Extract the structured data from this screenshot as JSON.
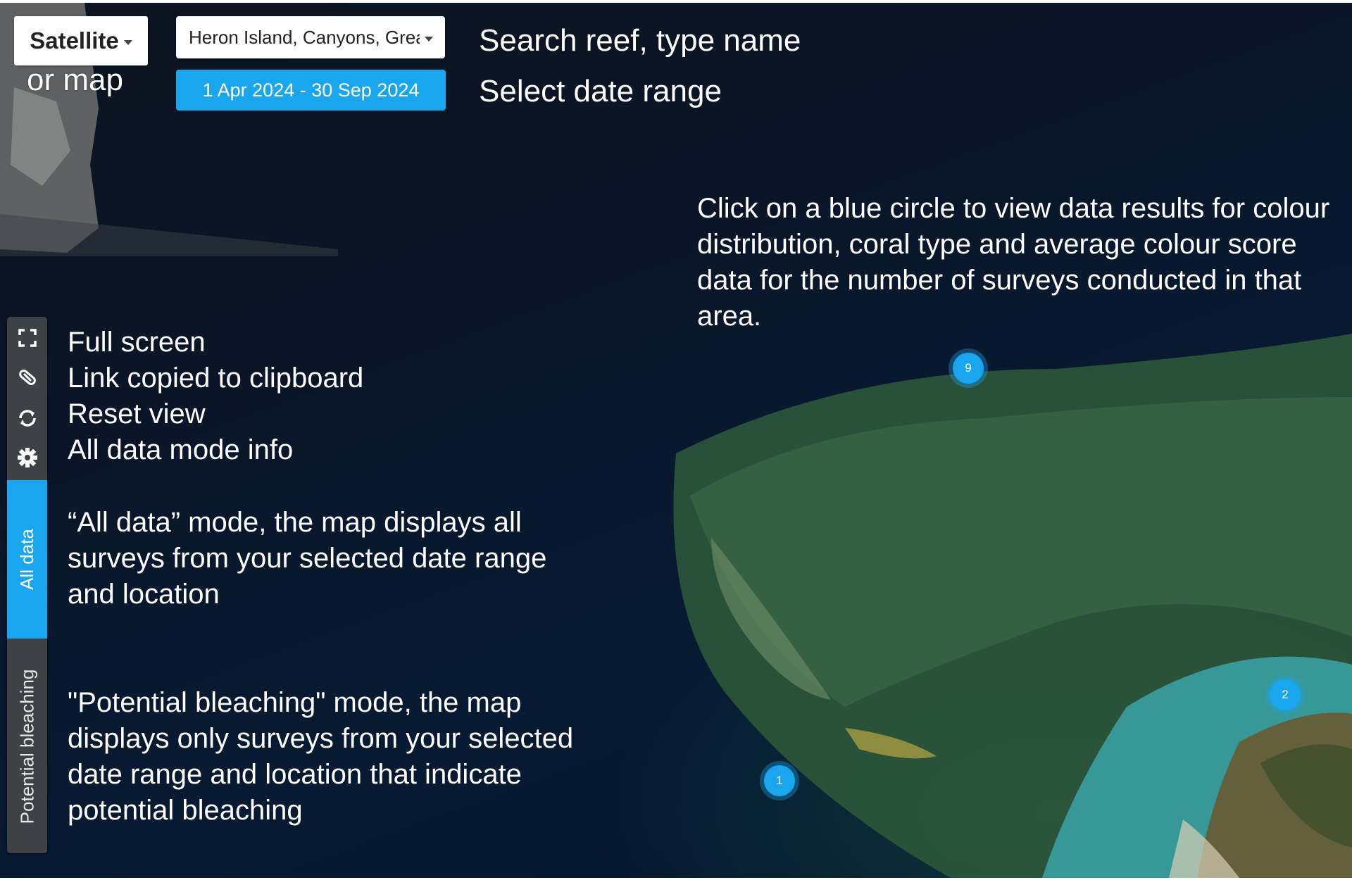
{
  "controls": {
    "map_type_label": "Satellite",
    "map_type_suffix": "or map",
    "reef_selected": "Heron Island, Canyons, Great Barrier Reef",
    "date_range": "1 Apr 2024 - 30 Sep 2024"
  },
  "annotations": {
    "search": "Search reef, type name",
    "date": "Select date range",
    "click_info": "Click on a blue circle to view data results for colour distribution, coral type and average colour score data for the number of surveys conducted in that area.",
    "toolbar_help": [
      "Full screen",
      "Link copied to clipboard",
      "Reset view",
      "All data mode info"
    ],
    "all_data_help": [
      "“All data” mode, the map displays all",
      "surveys from your selected date range",
      "and location"
    ],
    "bleaching_help": [
      "\"Potential bleaching\" mode, the map",
      "displays only surveys from your selected",
      "date range and location that indicate",
      "potential bleaching"
    ]
  },
  "toolbar": {
    "icons": [
      "fullscreen-icon",
      "link-icon",
      "reset-view-icon",
      "gear-icon"
    ],
    "tab_all_data": "All data",
    "tab_potential_bleaching": "Potential bleaching"
  },
  "markers": [
    {
      "id": "marker-9",
      "count": "9"
    },
    {
      "id": "marker-2",
      "count": "2"
    },
    {
      "id": "marker-1",
      "count": "1"
    }
  ],
  "colors": {
    "accent": "#1aa6ef",
    "toolbar_bg": "#3e4146",
    "map_bg": "#0a1628"
  }
}
